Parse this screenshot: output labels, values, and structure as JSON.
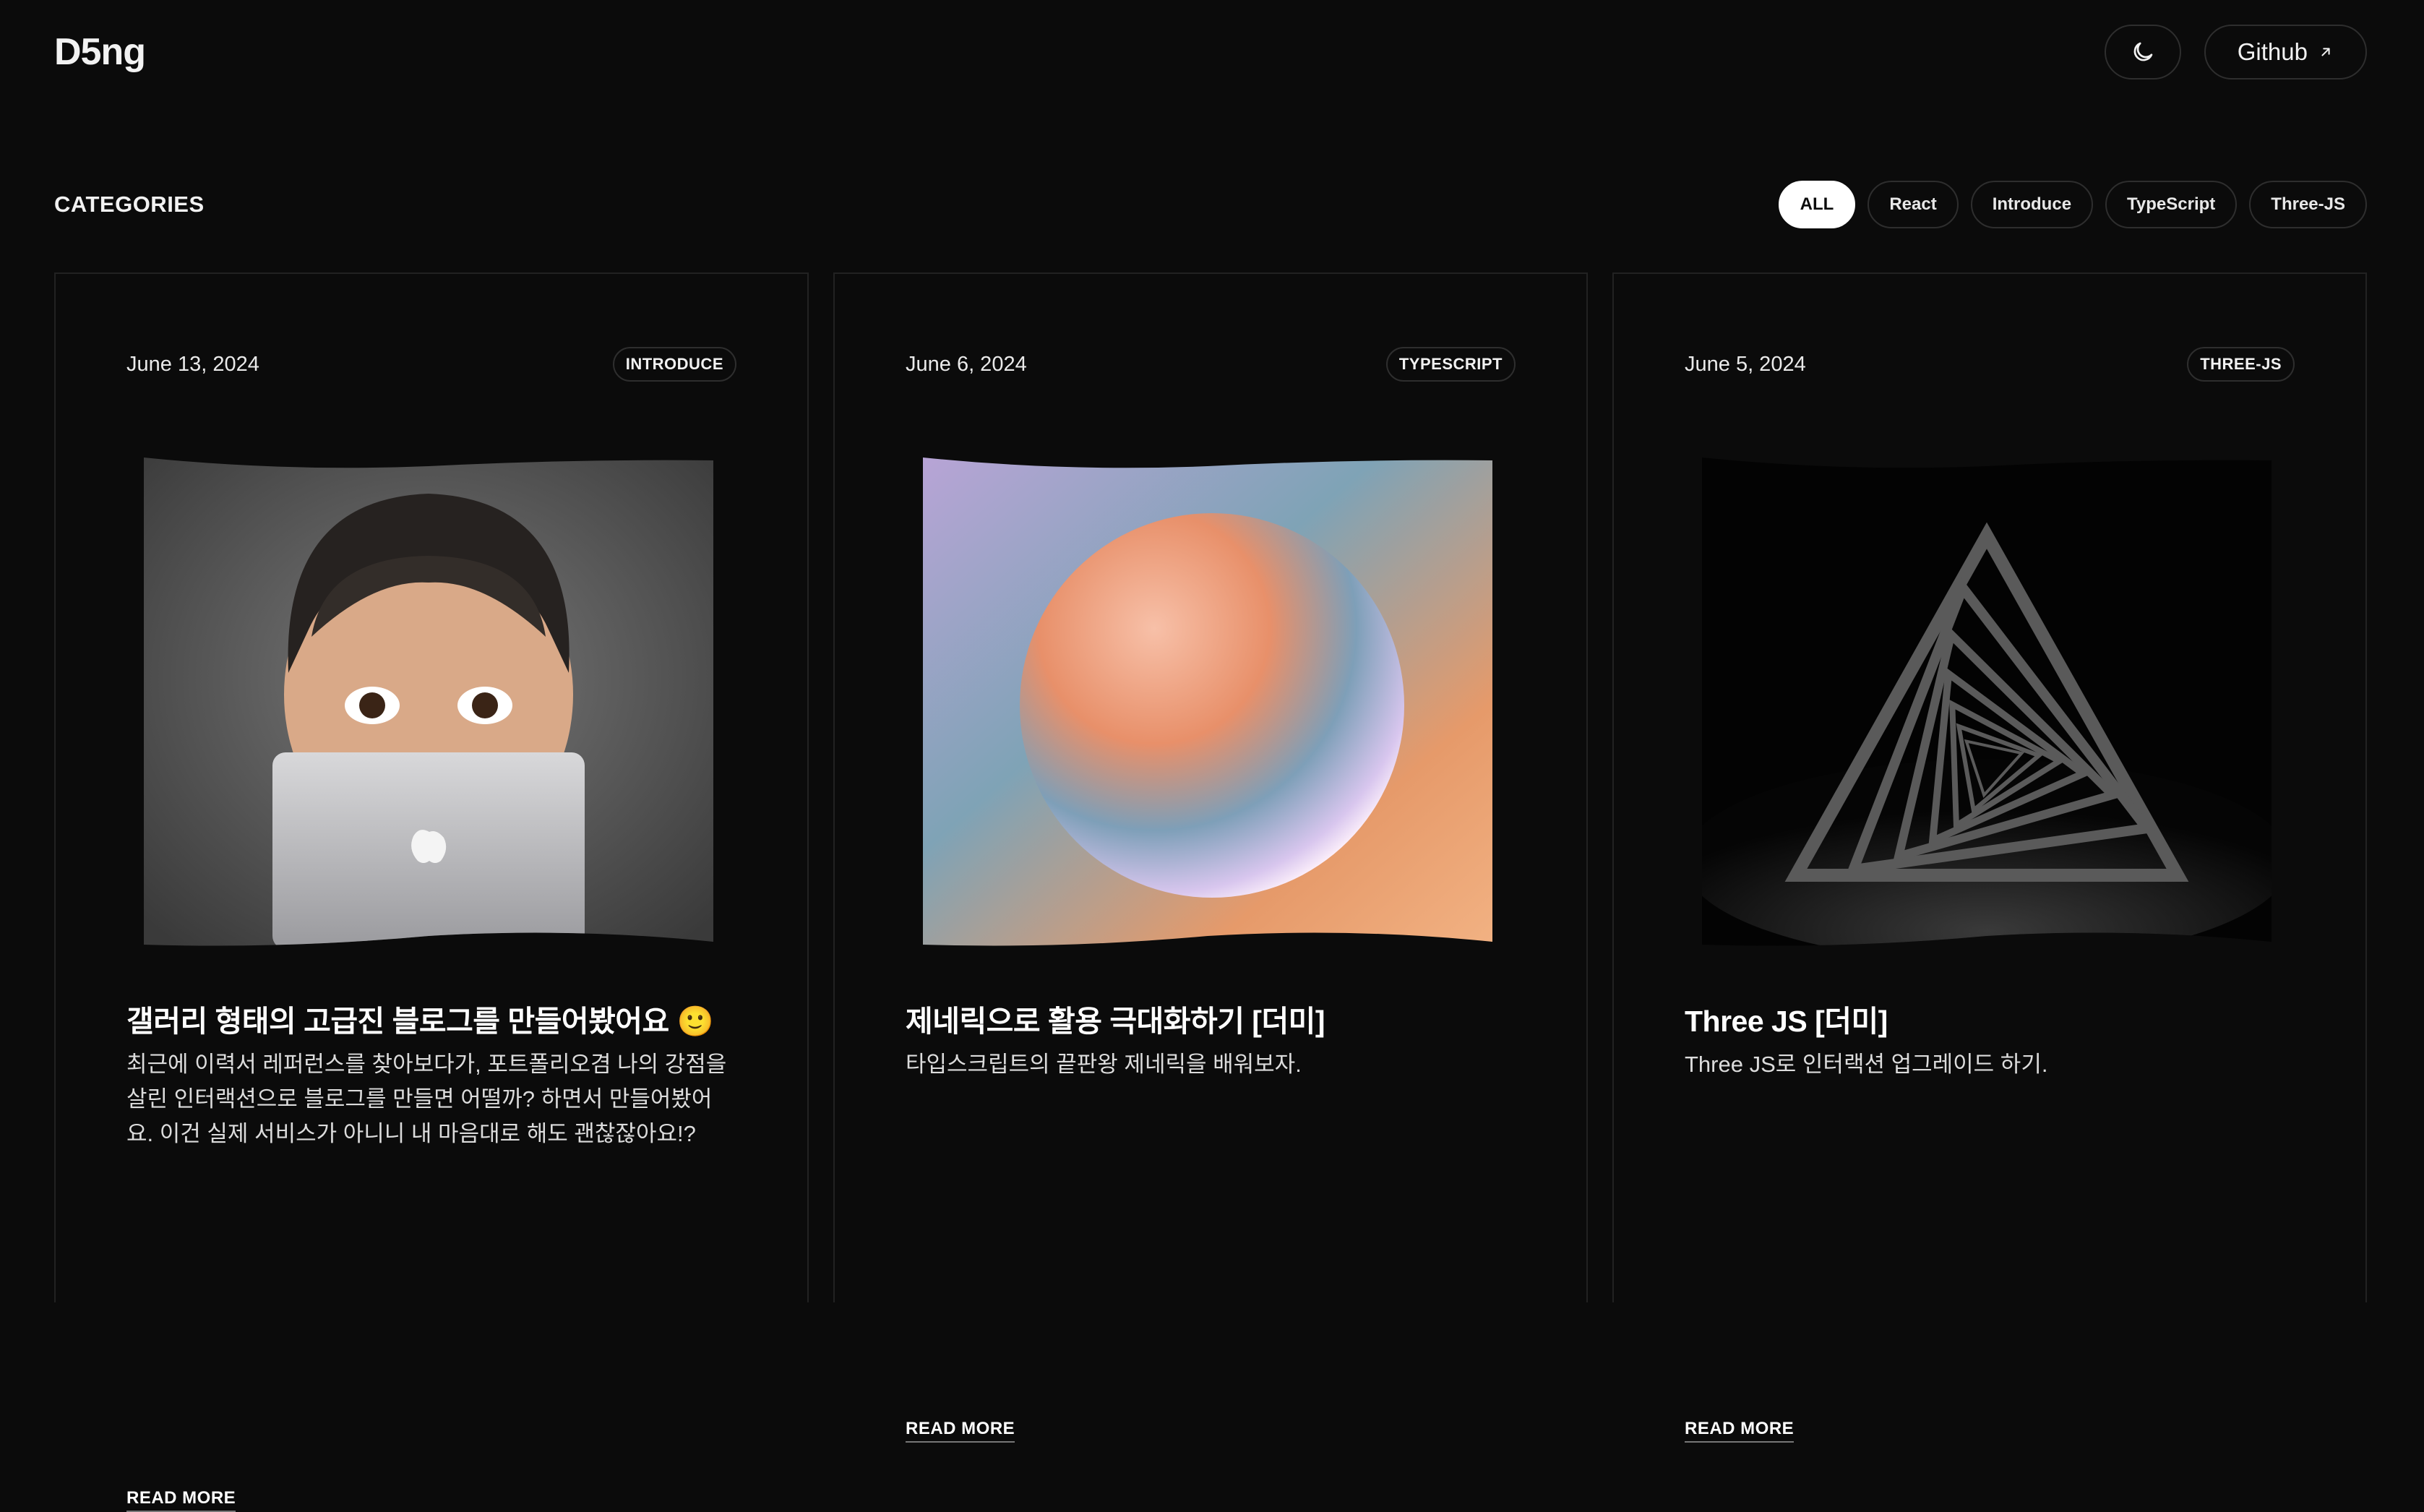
{
  "header": {
    "logo": "D5ng",
    "theme_icon": "moon-icon",
    "github_label": "Github",
    "github_icon": "arrow-up-right-icon"
  },
  "categories": {
    "title": "CATEGORIES",
    "items": [
      {
        "label": "ALL",
        "active": true
      },
      {
        "label": "React",
        "active": false
      },
      {
        "label": "Introduce",
        "active": false
      },
      {
        "label": "TypeScript",
        "active": false
      },
      {
        "label": "Three-JS",
        "active": false
      }
    ]
  },
  "posts": [
    {
      "date": "June 13, 2024",
      "tag": "INTRODUCE",
      "title": "갤러리 형태의 고급진 블로그를 만들어봤어요 🙂",
      "description": "최근에 이력서 레퍼런스를 찾아보다가, 포트폴리오겸 나의 강점을 살린 인터랙션으로 블로그를 만들면 어떨까? 하면서 만들어봤어요. 이건 실제 서비스가 아니니 내 마음대로 해도 괜찮잖아요!?",
      "read_more": "READ MORE",
      "image": "memoji-laptop-image"
    },
    {
      "date": "June 6, 2024",
      "tag": "TYPESCRIPT",
      "title": "제네릭으로 활용 극대화하기 [더미]",
      "description": "타입스크립트의 끝판왕 제네릭을 배워보자.",
      "read_more": "READ MORE",
      "image": "gradient-sphere-image"
    },
    {
      "date": "June 5, 2024",
      "tag": "THREE-JS",
      "title": "Three JS [더미]",
      "description": "Three JS로 인터랙션 업그레이드 하기.",
      "read_more": "READ MORE",
      "image": "triangle-tunnel-image"
    }
  ]
}
